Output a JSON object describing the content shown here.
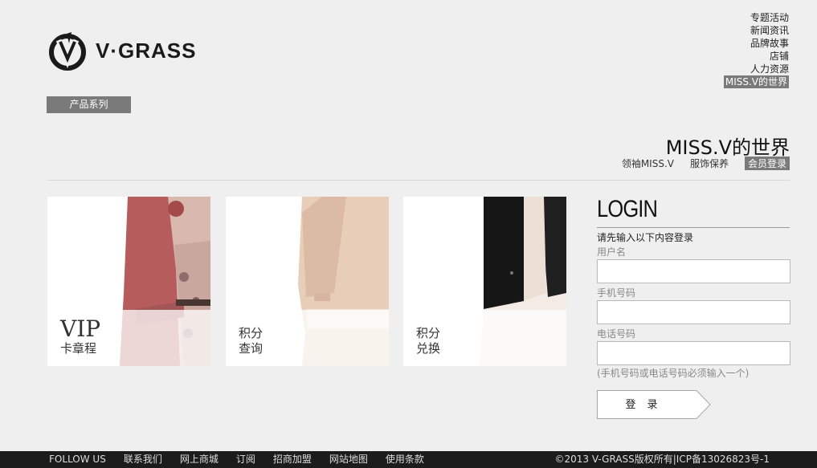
{
  "brand": {
    "name": "V·GRASS"
  },
  "topnav": {
    "items": [
      "专题活动",
      "新闻资讯",
      "品牌故事",
      "店铺",
      "人力资源",
      "MISS.V的世界"
    ]
  },
  "series": {
    "label": "产品系列"
  },
  "section": {
    "title": "MISS.V的世界",
    "subnav": [
      "领袖MISS.V",
      "服饰保养",
      "会员登录"
    ]
  },
  "cards": [
    {
      "big": "VIP",
      "line": "卡章程"
    },
    {
      "line1": "积分",
      "line2": "查询"
    },
    {
      "line1": "积分",
      "line2": "兑换"
    }
  ],
  "login": {
    "title": "LOGIN",
    "intro": "请先输入以下内容登录",
    "username_label": "用户名",
    "mobile_label": "手机号码",
    "phone_label": "电话号码",
    "hint": "(手机号码或电话号码必须输入一个)",
    "button": "登录"
  },
  "footer": {
    "links": [
      "FOLLOW US",
      "联系我们",
      "网上商城",
      "订阅",
      "招商加盟",
      "网站地图",
      "使用条款"
    ],
    "copyright": "©2013 V-GRASS版权所有|ICP备13026823号-1"
  }
}
